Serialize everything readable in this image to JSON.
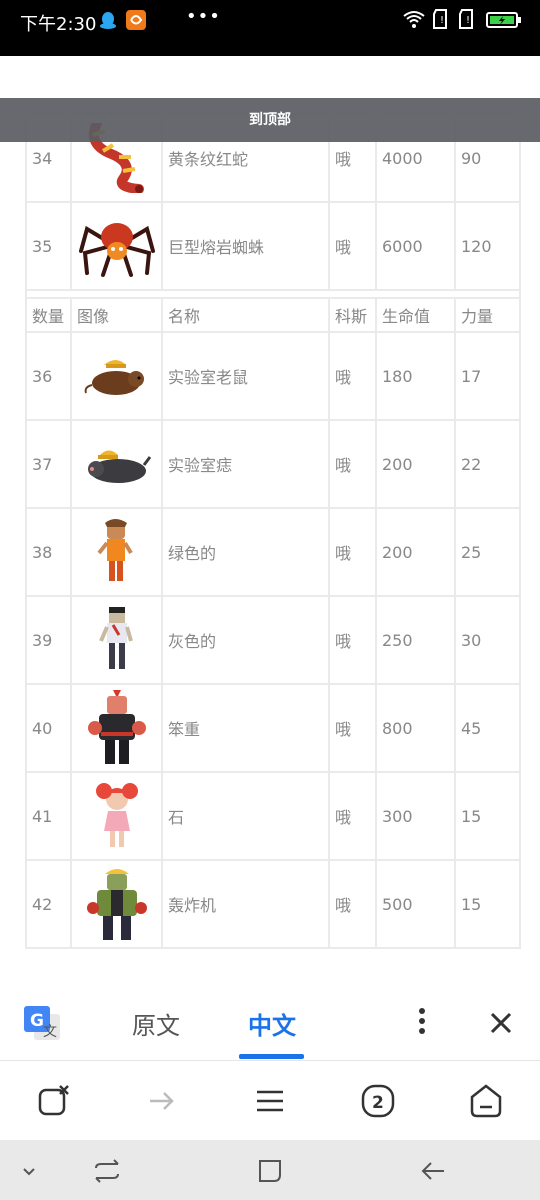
{
  "status_bar": {
    "time": "下午2:30",
    "overflow_label": "•••"
  },
  "back_to_top": "到顶部",
  "table": {
    "headers": [
      "数量",
      "图像",
      "名称",
      "科斯",
      "生命值",
      "力量"
    ],
    "rows_before": [
      {
        "num": "34",
        "image": "yellow-striped-red-snake",
        "name": "黄条纹红蛇",
        "kos": "哦",
        "hp": "4000",
        "power": "90"
      },
      {
        "num": "35",
        "image": "giant-lava-spider",
        "name": "巨型熔岩蜘蛛",
        "kos": "哦",
        "hp": "6000",
        "power": "120"
      }
    ],
    "rows_after": [
      {
        "num": "36",
        "image": "lab-rat",
        "name": "实验室老鼠",
        "kos": "哦",
        "hp": "180",
        "power": "17"
      },
      {
        "num": "37",
        "image": "lab-mole",
        "name": "实验室痣",
        "kos": "哦",
        "hp": "200",
        "power": "22"
      },
      {
        "num": "38",
        "image": "green-zombie",
        "name": "绿色的",
        "kos": "哦",
        "hp": "200",
        "power": "25"
      },
      {
        "num": "39",
        "image": "gray-zombie",
        "name": "灰色的",
        "kos": "哦",
        "hp": "250",
        "power": "30"
      },
      {
        "num": "40",
        "image": "clumsy-brute",
        "name": "笨重",
        "kos": "哦",
        "hp": "800",
        "power": "45"
      },
      {
        "num": "41",
        "image": "stone-girl",
        "name": "石",
        "kos": "哦",
        "hp": "300",
        "power": "15"
      },
      {
        "num": "42",
        "image": "bomber",
        "name": "轰炸机",
        "kos": "哦",
        "hp": "500",
        "power": "15"
      }
    ]
  },
  "translate_bar": {
    "original_label": "原文",
    "chinese_label": "中文",
    "logo_text": "文",
    "accent": "#1a73e8"
  },
  "nav": {
    "tab_count": "2"
  }
}
